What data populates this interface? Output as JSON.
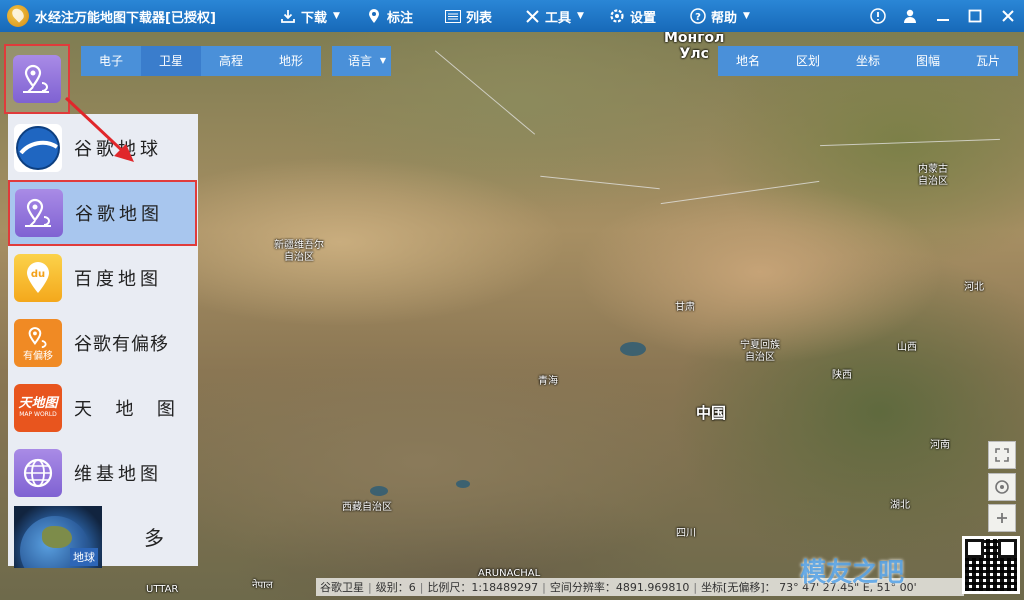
{
  "app": {
    "title": "水经注万能地图下载器[已授权]"
  },
  "toolbar": {
    "download": "下载",
    "mark": "标注",
    "list": "列表",
    "tools": "工具",
    "settings": "设置",
    "help": "帮助"
  },
  "basemap_tabs": [
    "电子",
    "卫星",
    "高程",
    "地形"
  ],
  "active_basemap_tab": "卫星",
  "language": {
    "label": "语言"
  },
  "overlay_tabs": [
    "地名",
    "区划",
    "坐标",
    "图幅",
    "瓦片"
  ],
  "map_menu": {
    "items": [
      {
        "label": "谷歌地球",
        "icon": "google-earth-icon"
      },
      {
        "label": "谷歌地图",
        "icon": "google-maps-icon",
        "selected": true
      },
      {
        "label": "百度地图",
        "icon": "baidu-map-icon",
        "icon_text": "du"
      },
      {
        "label": "谷歌有偏移",
        "icon": "google-maps-offset-icon",
        "icon_text": "有偏移"
      },
      {
        "label": "天  地  图",
        "icon": "tianditu-icon",
        "icon_text": "天地图",
        "icon_subtext": "MAP WORLD"
      },
      {
        "label": "维基地图",
        "icon": "wikimapia-icon"
      }
    ],
    "more": {
      "thumb_caption": "地球",
      "label": "多"
    }
  },
  "map_labels": {
    "mongolia": "Монгол\nУлс",
    "inner_mongolia": "内蒙古\n自治区",
    "xinjiang": "新疆维吾尔\n自治区",
    "gansu": "甘肃",
    "ningxia": "宁夏回族\n自治区",
    "hebei": "河北",
    "shanxi": "山西",
    "shaanxi": "陕西",
    "qinghai": "青海",
    "china": "中国",
    "henan": "河南",
    "hubei": "湖北",
    "xizang": "西藏自治区",
    "sichuan": "四川",
    "arunachal": "ARUNACHAL",
    "uttar": "UTTAR",
    "nepal": "नेपाल"
  },
  "statusbar": {
    "source": "谷歌卫星",
    "level": "级别：6",
    "scale": "比例尺：1:18489297",
    "resolution": "空间分辨率：4891.969810",
    "coord": "坐标[无偏移]： 73° 47' 27.45\" E, 51° 00'"
  },
  "watermark": "模友之吧",
  "colors": {
    "accent": "#2a86d6",
    "highlight_border": "#e03b3b",
    "selected_bg": "#a8c6ee"
  }
}
